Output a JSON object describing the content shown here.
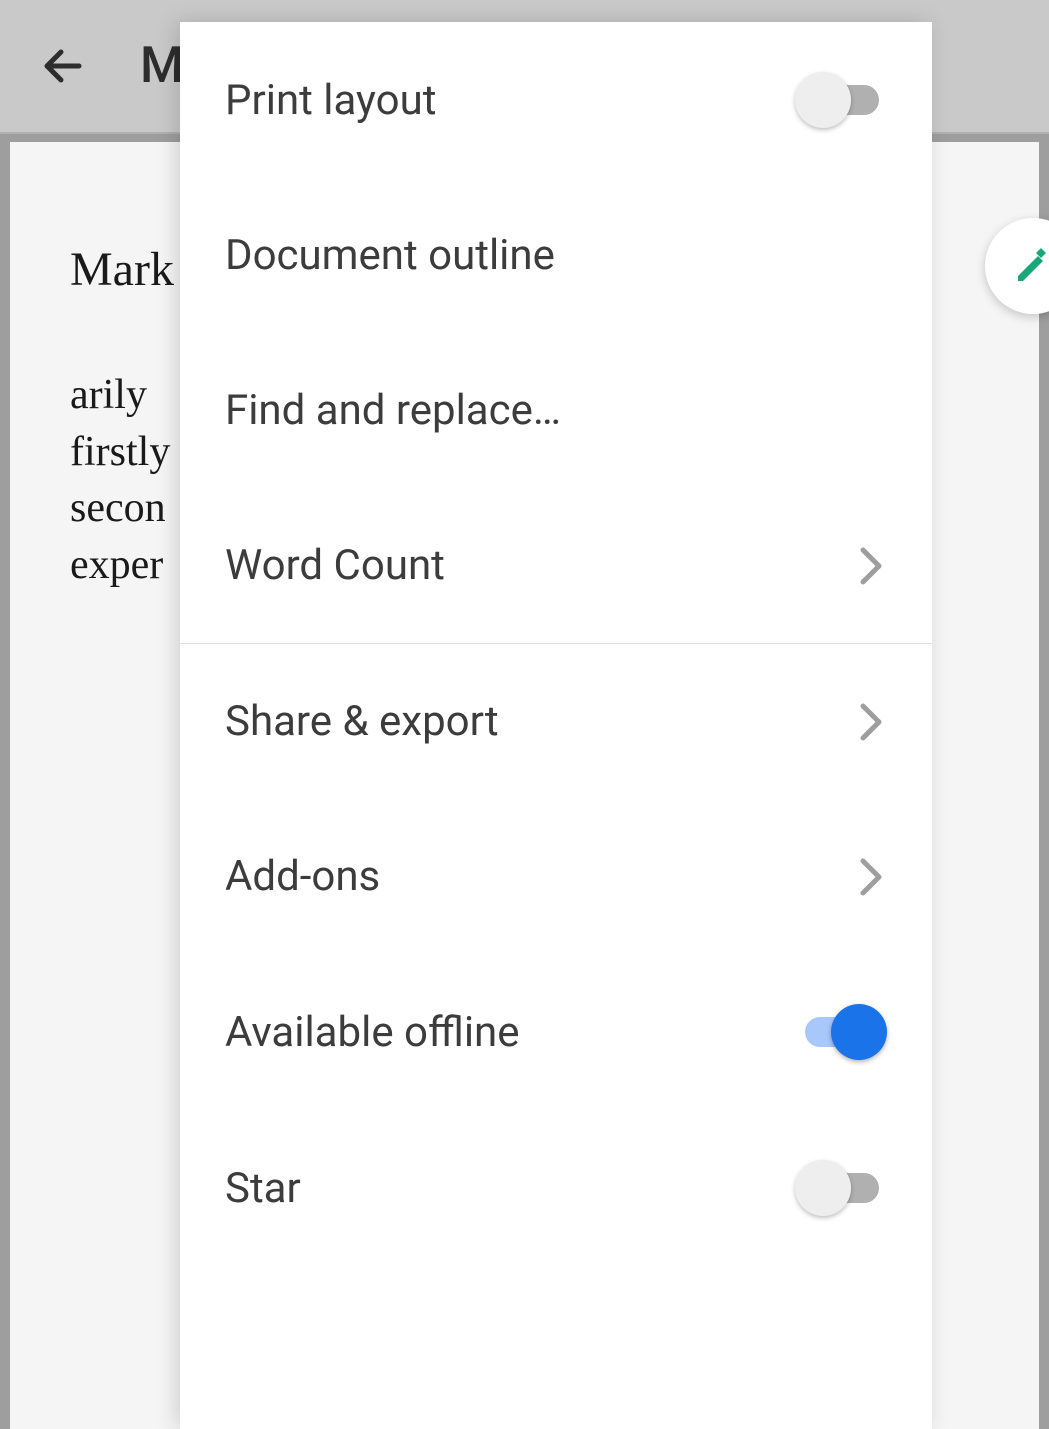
{
  "header": {
    "title_visible": "M"
  },
  "document": {
    "heading_visible": "Mark",
    "lines": [
      "arily",
      "firstly",
      "secon",
      "exper"
    ]
  },
  "menu": {
    "print_layout": {
      "label": "Print layout",
      "enabled": false
    },
    "document_outline": {
      "label": "Document outline"
    },
    "find_replace": {
      "label": "Find and replace…"
    },
    "word_count": {
      "label": "Word Count"
    },
    "share_export": {
      "label": "Share & export"
    },
    "add_ons": {
      "label": "Add-ons"
    },
    "available_offline": {
      "label": "Available offline",
      "enabled": true
    },
    "star": {
      "label": "Star",
      "enabled": false
    }
  }
}
